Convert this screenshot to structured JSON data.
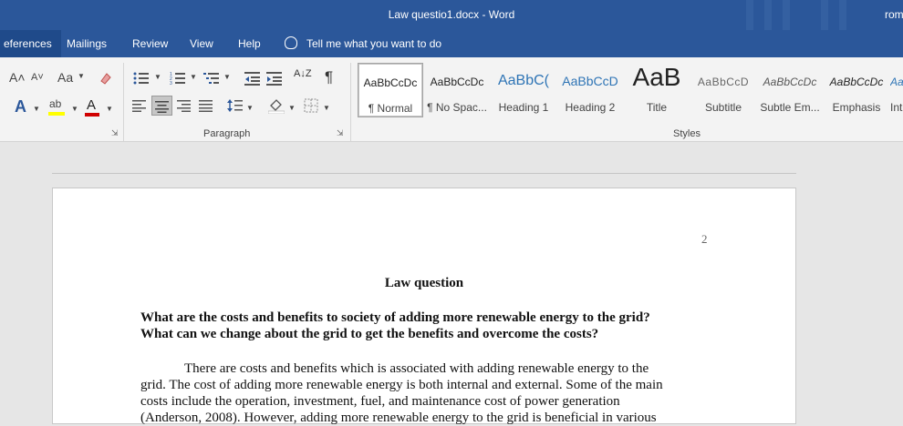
{
  "window": {
    "title": "Law questio1.docx  -  Word",
    "user": "rom"
  },
  "tabs": [
    {
      "label": "eferences"
    },
    {
      "label": "Mailings"
    },
    {
      "label": "Review"
    },
    {
      "label": "View"
    },
    {
      "label": "Help"
    }
  ],
  "tell_me": "Tell me what you want to do",
  "ribbon": {
    "font_grow": "A˄",
    "font_shrink": "A˅",
    "change_case": "Aa",
    "text_effects": "A",
    "highlight": "ab",
    "font_color": "A",
    "pilcrow": "¶",
    "sort": "A↓Z",
    "group_paragraph": "Paragraph",
    "group_styles": "Styles",
    "colors": {
      "highlight": "#ffff00",
      "font_color": "#d00000",
      "accent": "#2b579a"
    }
  },
  "styles": [
    {
      "sample": "AaBbCcDc",
      "name": "¶ Normal"
    },
    {
      "sample": "AaBbCcDc",
      "name": "¶ No Spac..."
    },
    {
      "sample": "AaBbC(",
      "name": "Heading 1"
    },
    {
      "sample": "AaBbCcD",
      "name": "Heading 2"
    },
    {
      "sample": "AaB",
      "name": "Title"
    },
    {
      "sample": "AaBbCcD",
      "name": "Subtitle"
    },
    {
      "sample": "AaBbCcDc",
      "name": "Subtle Em..."
    },
    {
      "sample": "AaBbCcDc",
      "name": "Emphasis"
    },
    {
      "sample": "Aa",
      "name": "Int"
    }
  ],
  "document": {
    "page_number": "2",
    "title": "Law question",
    "question_lines": [
      "What are the costs and benefits to society of adding more renewable energy to the grid?",
      "What can we change about the grid to get the benefits and overcome the costs?"
    ],
    "body_lines": [
      "There are costs and benefits which is associated with adding renewable energy to the",
      "grid. The cost of adding more renewable energy is both internal and external. Some of the main",
      "costs include the operation, investment, fuel, and maintenance cost of power generation",
      "(Anderson, 2008). However, adding more renewable energy to the grid is beneficial in various"
    ]
  }
}
